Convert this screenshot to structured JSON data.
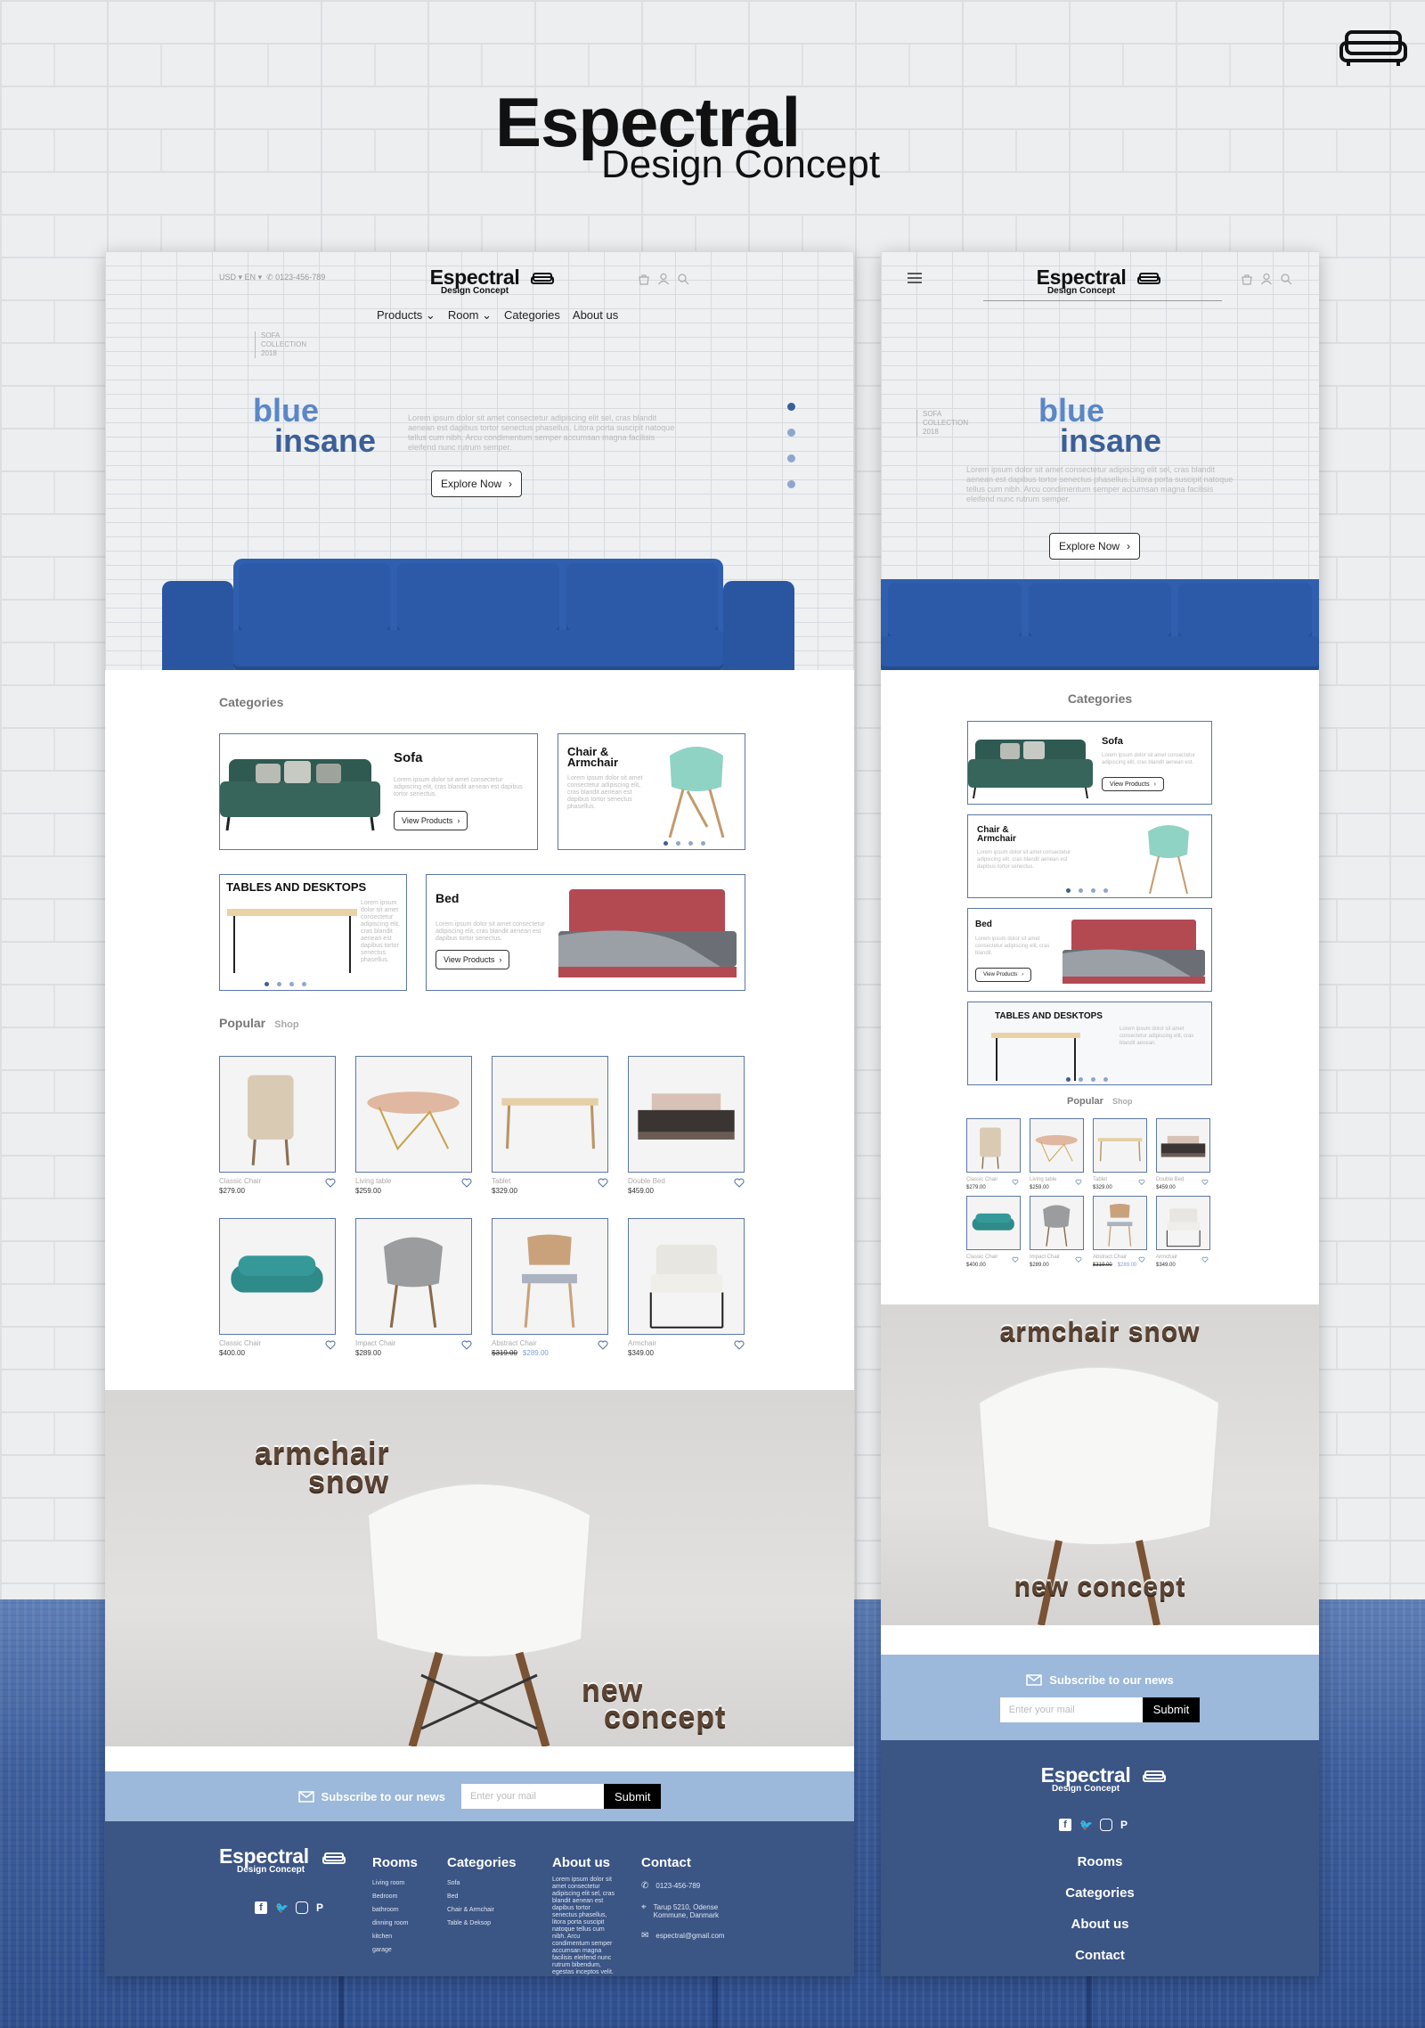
{
  "poster": {
    "title": "Espectral",
    "subtitle": "Design Concept"
  },
  "colors": {
    "brand_blue": "#3b5f98",
    "light_blue": "#5a87c5",
    "footer_blue": "#3b5585",
    "subscribe_bg": "#9cb8da",
    "card_border": "#5b77a8"
  },
  "desktop": {
    "topbar": {
      "currency": "USD",
      "language": "EN",
      "phone": "0123-456-789"
    },
    "logo": {
      "name": "Espectral",
      "tagline": "Design Concept"
    },
    "nav": [
      "Products",
      "Room",
      "Categories",
      "About us"
    ],
    "header_icons": [
      "bag-icon",
      "user-icon",
      "search-icon"
    ],
    "hero": {
      "collection": [
        "SOFA",
        "COLLECTION",
        "2018"
      ],
      "headline_1": "blue",
      "headline_2": "insane",
      "text": "Lorem ipsum dolor sit amet consectetur adipiscing elit sel, cras blandit aenean est dapibus tortor senectus phasellus. Litora porta suscipit natoque tellus cum nibh. Arcu condimentum semper accumsan magna facilisis eleifend nunc rutrum semper.",
      "button": "Explore Now"
    },
    "categories": {
      "title": "Categories",
      "sofa": {
        "title": "Sofa",
        "text": "Lorem ipsum dolor sit amet consectetur adipiscing elit, cras blandit aenean est dapibus tortor senectus.",
        "button": "View Products"
      },
      "chair": {
        "title": "Chair &",
        "title2": "Armchair",
        "text": "Lorem ipsum dolor sit amet consectetur adipiscing elit, cras blandit aenean est dapibus tortor senectus phasellus."
      },
      "tables": {
        "title": "TABLES AND DESKTOPS",
        "text": "Lorem ipsum dolor sit amet consectetur adipiscing elit, cras blandit aenean est dapibus tortor senectus phasellus."
      },
      "bed": {
        "title": "Bed",
        "text": "Lorem ipsum dolor sit amet consectetur adipiscing elit, cras blandit aenean est dapibus tortor senectus.",
        "button": "View Products"
      }
    },
    "popular": {
      "title": "Popular",
      "shop": "Shop",
      "products": [
        {
          "name": "Classic Chair",
          "price": "$279.00"
        },
        {
          "name": "Living table",
          "price": "$259.00"
        },
        {
          "name": "Tablet",
          "price": "$329.00"
        },
        {
          "name": "Double Bed",
          "price": "$459.00"
        },
        {
          "name": "Classic Chair",
          "price": "$400.00"
        },
        {
          "name": "Impact Chair",
          "price": "$289.00"
        },
        {
          "name": "Abstract Chair",
          "price": "$319.00",
          "sale": "$289.00"
        },
        {
          "name": "Armchair",
          "price": "$349.00"
        }
      ]
    },
    "banner": {
      "line1": "armchair",
      "line2": "snow",
      "line3": "new",
      "line4": "concept"
    },
    "subscribe": {
      "label": "Subscribe to our news",
      "placeholder": "Enter your mail",
      "button": "Submit"
    },
    "footer": {
      "rooms_title": "Rooms",
      "rooms": [
        "Living room",
        "Bedroom",
        "bathroom",
        "dinning room",
        "kitchen",
        "garage"
      ],
      "categories_title": "Categories",
      "categories": [
        "Sofa",
        "Bed",
        "Chair & Armchair",
        "Table & Deksop"
      ],
      "about_title": "About us",
      "about_text": "Lorem ipsum dolor sit amet consectetur adipiscing elit sel, cras blandit aenean est dapibus tortor senectus phasellus, litora porta suscipit natoque tellus cum nibh. Arcu condimentum semper accumsan magna facilisis eleifend nunc rutrum bibendum, egestas inceptos velit.",
      "contact_title": "Contact",
      "phone": "0123-456-789",
      "address_1": "Tarup 5210, Odense",
      "address_2": "Kommune, Danmark",
      "email": "espectral@gmail.com"
    }
  },
  "mobile": {
    "logo": {
      "name": "Espectral",
      "tagline": "Design Concept"
    },
    "hero": {
      "collection": [
        "SOFA",
        "COLLECTION",
        "2018"
      ],
      "headline_1": "blue",
      "headline_2": "insane",
      "text": "Lorem ipsum dolor sit amet consectetur adipiscing elit sel, cras blandit aenean est dapibus tortor senectus phasellus. Litora porta suscipit natoque tellus cum nibh. Arcu condimentum semper accumsan magna facilisis eleifend nunc rutrum semper.",
      "button": "Explore Now"
    },
    "categories": {
      "title": "Categories",
      "sofa": {
        "title": "Sofa",
        "text": "Lorem ipsum dolor sit amet consectetur adipiscing elit, cras blandit aenean est.",
        "button": "View Products"
      },
      "chair": {
        "title": "Chair &",
        "title2": "Armchair",
        "text": "Lorem ipsum dolor sit amet consectetur adipiscing elit, cras blandit aenean est dapibus tortor senectus."
      },
      "bed": {
        "title": "Bed",
        "text": "Lorem ipsum dolor sit amet consectetur adipiscing elit, cras blandit.",
        "button": "View Products"
      },
      "tables": {
        "title": "TABLES AND DESKTOPS",
        "text": "Lorem ipsum dolor sit amet consectetur adipiscing elit, cras blandit aenean."
      }
    },
    "popular": {
      "title": "Popular",
      "shop": "Shop",
      "products": [
        {
          "name": "Classic Chair",
          "price": "$279.00"
        },
        {
          "name": "Living table",
          "price": "$259.00"
        },
        {
          "name": "Tablet",
          "price": "$329.00"
        },
        {
          "name": "Double Bed",
          "price": "$459.00"
        },
        {
          "name": "Classic Chair",
          "price": "$400.00"
        },
        {
          "name": "Impact Chair",
          "price": "$289.00"
        },
        {
          "name": "Abstract Chair",
          "price": "$319.00",
          "sale": "$289.00"
        },
        {
          "name": "Armchair",
          "price": "$349.00"
        }
      ]
    },
    "banner": {
      "top": "armchair snow",
      "bottom": "new concept"
    },
    "subscribe": {
      "label": "Subscribe to our news",
      "placeholder": "Enter your mail",
      "button": "Submit"
    },
    "footer": {
      "links": [
        "Rooms",
        "Categories",
        "About us",
        "Contact"
      ]
    }
  }
}
